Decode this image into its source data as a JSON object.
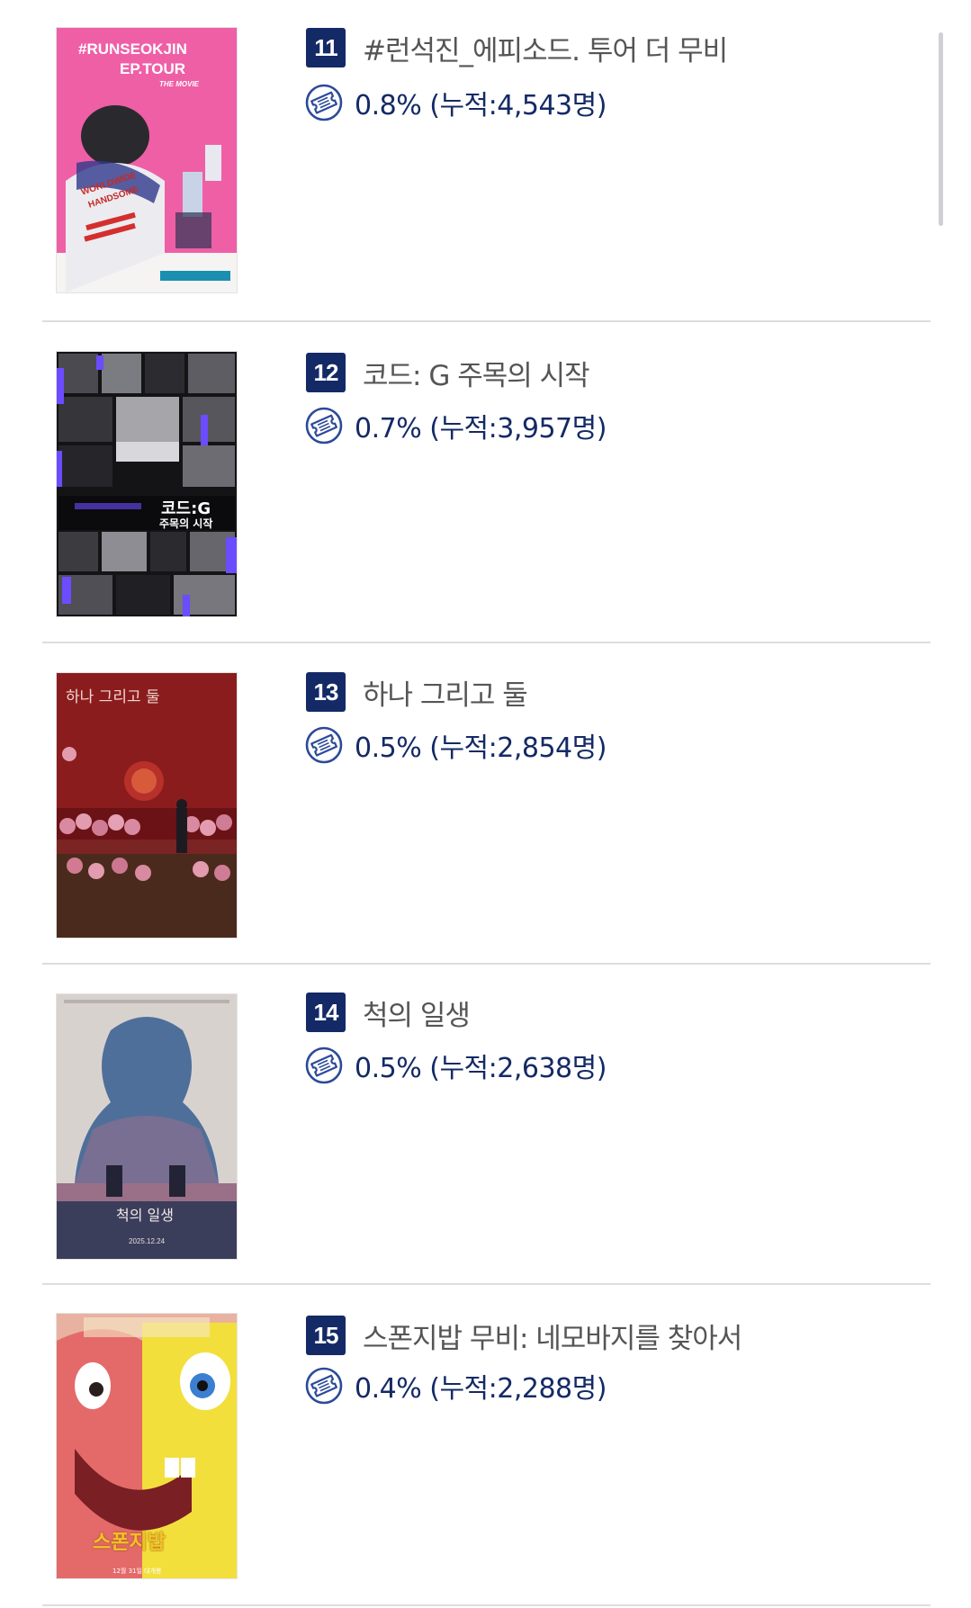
{
  "colors": {
    "badge_bg": "#142a66",
    "stat_text": "#142a66",
    "title_text": "#555555",
    "divider": "#dddddd"
  },
  "icons": {
    "stat_icon": "ticket-icon"
  },
  "movies": [
    {
      "rank": "11",
      "title": "#런석진_에피소드. 투어 더 무비",
      "stat": "0.8% (누적:4,543명)",
      "share_percent": 0.8,
      "cumulative_audience": 4543,
      "poster_text": [
        "#RUNSEOKJIN",
        "EP.TOUR",
        "THE MOVIE",
        "WORLDWIDE",
        "HANDSOME"
      ]
    },
    {
      "rank": "12",
      "title": "코드: G 주목의 시작",
      "stat": "0.7% (누적:3,957명)",
      "share_percent": 0.7,
      "cumulative_audience": 3957,
      "poster_text": [
        "코드:G",
        "주목의 시작"
      ]
    },
    {
      "rank": "13",
      "title": "하나 그리고 둘",
      "stat": "0.5% (누적:2,854명)",
      "share_percent": 0.5,
      "cumulative_audience": 2854,
      "poster_text": [
        "하나 그리고 둘"
      ]
    },
    {
      "rank": "14",
      "title": "척의 일생",
      "stat": "0.5% (누적:2,638명)",
      "share_percent": 0.5,
      "cumulative_audience": 2638,
      "poster_text": [
        "척의 일생",
        "2025.12.24"
      ]
    },
    {
      "rank": "15",
      "title": "스폰지밥 무비: 네모바지를 찾아서",
      "stat": "0.4% (누적:2,288명)",
      "share_percent": 0.4,
      "cumulative_audience": 2288,
      "poster_text": [
        "스폰지밥",
        "12월 31일 대개봉"
      ]
    }
  ]
}
